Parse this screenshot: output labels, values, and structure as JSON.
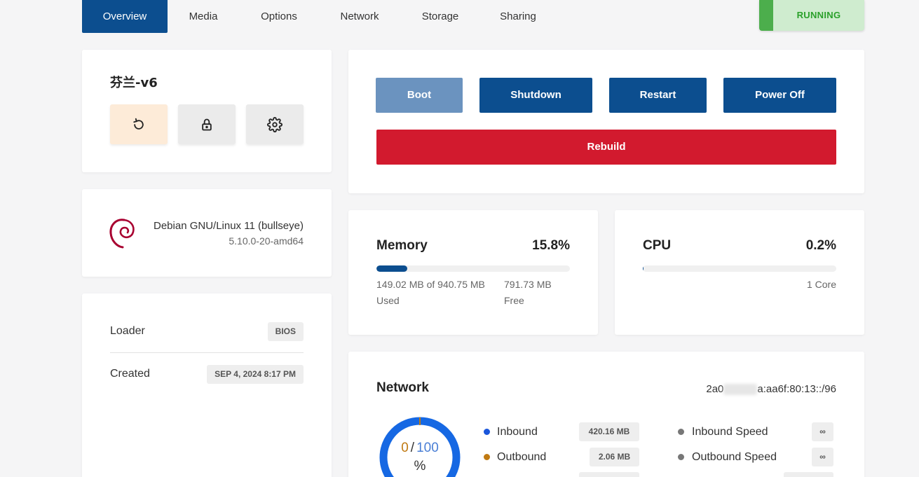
{
  "tabs": [
    {
      "label": "Overview",
      "active": true
    },
    {
      "label": "Media"
    },
    {
      "label": "Options"
    },
    {
      "label": "Network"
    },
    {
      "label": "Storage"
    },
    {
      "label": "Sharing"
    }
  ],
  "status": "RUNNING",
  "vm": {
    "name": "芬兰-v6",
    "buttons": [
      "reinstall-icon",
      "lock-icon",
      "gear-icon"
    ]
  },
  "os": {
    "name": "Debian GNU/Linux 11 (bullseye)",
    "kernel": "5.10.0-20-amd64",
    "logo": "debian-logo"
  },
  "info": {
    "loader_label": "Loader",
    "loader_value": "BIOS",
    "created_label": "Created",
    "created_value": "SEP 4, 2024 8:17 PM"
  },
  "power": {
    "boot": "Boot",
    "shutdown": "Shutdown",
    "restart": "Restart",
    "poweroff": "Power Off",
    "rebuild": "Rebuild"
  },
  "memory": {
    "title": "Memory",
    "percent": "15.8%",
    "fraction": 0.158,
    "used": "149.02 MB of 940.75 MB",
    "used_label": "Used",
    "free": "791.73 MB",
    "free_label": "Free"
  },
  "cpu": {
    "title": "CPU",
    "percent": "0.2%",
    "fraction": 0.002,
    "cores": "1 Core"
  },
  "network": {
    "title": "Network",
    "ip_prefix": "2a0",
    "ip_suffix": "a:aa6f:80:13::/96",
    "gauge_value": "0",
    "gauge_sep": "/",
    "gauge_max": "100",
    "gauge_unit": "%",
    "inbound_label": "Inbound",
    "inbound_value": "420.16 MB",
    "outbound_label": "Outbound",
    "outbound_value": "2.06 MB",
    "inbound_speed_label": "Inbound Speed",
    "inbound_speed_value": "∞",
    "outbound_speed_label": "Outbound Speed",
    "outbound_speed_value": "∞",
    "colors": {
      "inbound": "#1a56db",
      "outbound": "#c07a12",
      "speed": "#777777",
      "gauge": "#1668e3"
    }
  },
  "colors": {
    "primary": "#0c4e8f",
    "danger": "#d21a2e",
    "running": "#2aa02a"
  }
}
